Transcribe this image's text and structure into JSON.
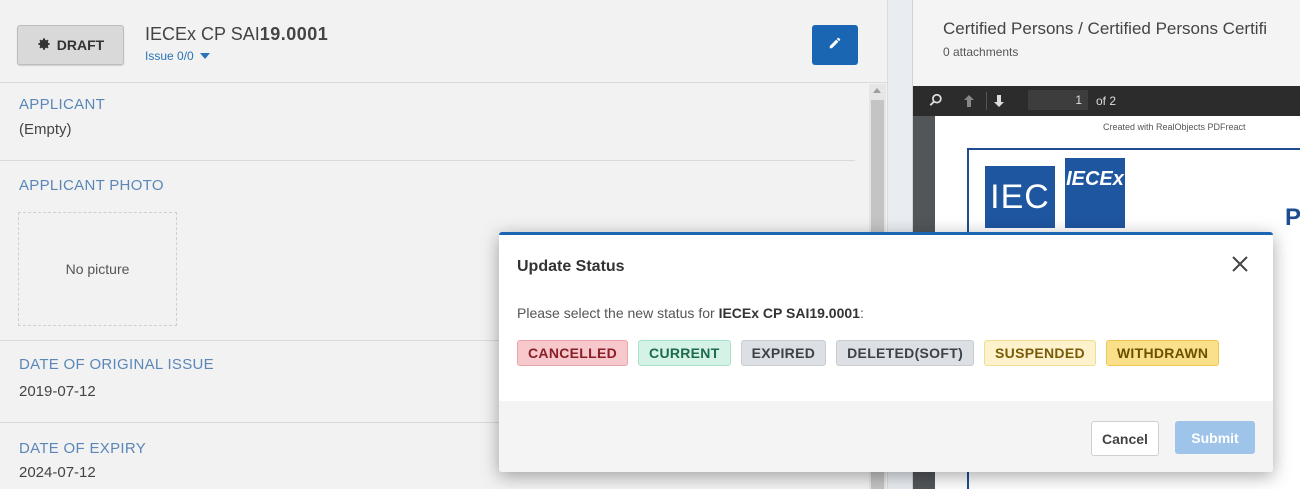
{
  "header": {
    "draft_label": "DRAFT",
    "title_prefix": "IECEx CP SAI",
    "title_number": "19.0001",
    "issue_label": "Issue 0/0"
  },
  "fields": {
    "applicant_label": "APPLICANT",
    "applicant_value": "(Empty)",
    "photo_label": "APPLICANT PHOTO",
    "photo_placeholder": "No picture",
    "original_issue_label": "DATE OF ORIGINAL ISSUE",
    "original_issue_value": "2019-07-12",
    "expiry_label": "DATE OF EXPIRY",
    "expiry_value": "2024-07-12"
  },
  "right_panel": {
    "title": "Certified Persons / Certified Persons Certifi",
    "attachments": "0 attachments",
    "pdf": {
      "page_current": "1",
      "page_total": "of 2",
      "created_with": "Created with RealObjects PDFreact",
      "logo_iec": "IEC",
      "logo_iecex": "IECEx",
      "heading_fragment": "P"
    }
  },
  "modal": {
    "title": "Update Status",
    "message_prefix": "Please select the new status for ",
    "message_target": "IECEx CP SAI19.0001",
    "message_suffix": ":",
    "statuses": [
      {
        "label": "CANCELLED",
        "bg": "#f8c9cc",
        "border": "#e8a5aa",
        "color": "#8a1f28"
      },
      {
        "label": "CURRENT",
        "bg": "#d4f3e6",
        "border": "#a9e0c9",
        "color": "#1c6b4a"
      },
      {
        "label": "EXPIRED",
        "bg": "#dcdfe3",
        "border": "#c8ccd1",
        "color": "#3c4249"
      },
      {
        "label": "DELETED(SOFT)",
        "bg": "#dcdfe3",
        "border": "#c8ccd1",
        "color": "#3c4249"
      },
      {
        "label": "SUSPENDED",
        "bg": "#fdf2cc",
        "border": "#f1dc95",
        "color": "#7a5b06"
      },
      {
        "label": "WITHDRAWN",
        "bg": "#fbe08b",
        "border": "#efc74f",
        "color": "#6e4f00"
      }
    ],
    "cancel_label": "Cancel",
    "submit_label": "Submit"
  }
}
